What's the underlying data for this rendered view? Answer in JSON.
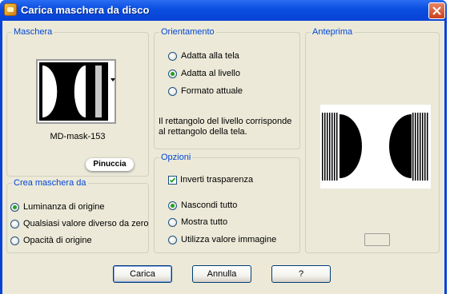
{
  "window": {
    "title": "Carica maschera da disco"
  },
  "mask": {
    "legend": "Maschera",
    "name": "MD-mask-153",
    "badge": "Pinuccia"
  },
  "orientation": {
    "legend": "Orientamento",
    "options": [
      {
        "label": "Adatta alla tela",
        "selected": false
      },
      {
        "label": "Adatta al livello",
        "selected": true
      },
      {
        "label": "Formato attuale",
        "selected": false
      }
    ],
    "description": "Il rettangolo del livello corrisponde al rettangolo della tela."
  },
  "preview": {
    "legend": "Anteprima"
  },
  "create_mask": {
    "legend": "Crea maschera da",
    "options": [
      {
        "label": "Luminanza di origine",
        "selected": true
      },
      {
        "label": "Qualsiasi valore diverso da zero",
        "selected": false
      },
      {
        "label": "Opacità di origine",
        "selected": false
      }
    ]
  },
  "options": {
    "legend": "Opzioni",
    "invert": {
      "label": "Inverti trasparenza",
      "checked": true
    },
    "radios": [
      {
        "label": "Nascondi tutto",
        "selected": true
      },
      {
        "label": "Mostra tutto",
        "selected": false
      },
      {
        "label": "Utilizza valore immagine",
        "selected": false
      }
    ]
  },
  "buttons": {
    "load": "Carica",
    "cancel": "Annulla",
    "help": "?"
  },
  "colors": {
    "title_bar": "#0842d6",
    "client_bg": "#ece9d8",
    "group_legend": "#0046d5",
    "close_button": "#c8421c"
  }
}
